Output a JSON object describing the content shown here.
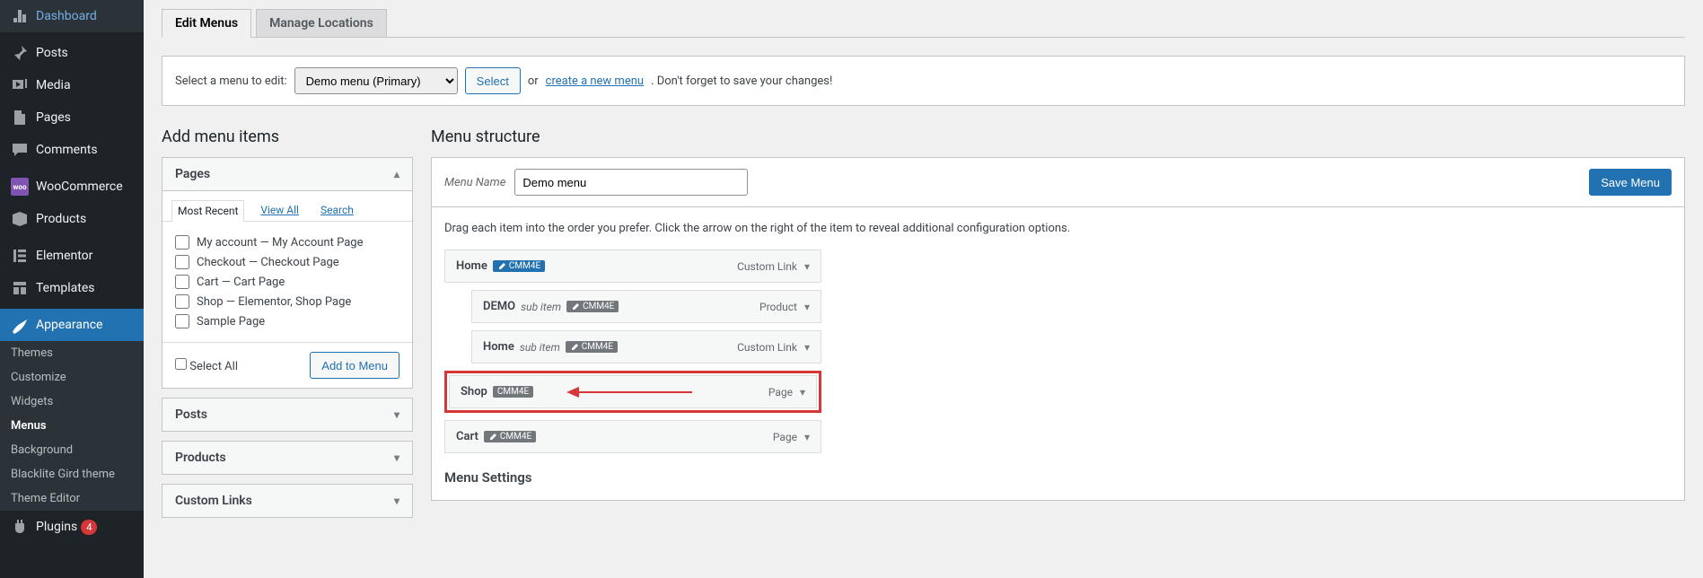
{
  "sidebar": {
    "items": [
      {
        "label": "Dashboard",
        "icon": "dashboard"
      },
      {
        "label": "Posts",
        "icon": "pin"
      },
      {
        "label": "Media",
        "icon": "media"
      },
      {
        "label": "Pages",
        "icon": "pages"
      },
      {
        "label": "Comments",
        "icon": "comments"
      },
      {
        "label": "WooCommerce",
        "icon": "woo"
      },
      {
        "label": "Products",
        "icon": "products"
      },
      {
        "label": "Elementor",
        "icon": "elementor"
      },
      {
        "label": "Templates",
        "icon": "templates"
      },
      {
        "label": "Appearance",
        "icon": "appearance",
        "active": true
      },
      {
        "label": "Plugins",
        "icon": "plugins",
        "badge": "4"
      }
    ],
    "submenu": [
      {
        "label": "Themes"
      },
      {
        "label": "Customize"
      },
      {
        "label": "Widgets"
      },
      {
        "label": "Menus",
        "current": true
      },
      {
        "label": "Background"
      },
      {
        "label": "Blacklite Gird theme"
      },
      {
        "label": "Theme Editor"
      }
    ]
  },
  "tabs": {
    "edit": "Edit Menus",
    "locations": "Manage Locations"
  },
  "edit_bar": {
    "prompt": "Select a menu to edit:",
    "selected": "Demo menu (Primary)",
    "select_btn": "Select",
    "or": "or",
    "create_link": "create a new menu",
    "suffix": ". Don't forget to save your changes!"
  },
  "left": {
    "title": "Add menu items",
    "accordion": {
      "pages": "Pages",
      "posts": "Posts",
      "products": "Products",
      "custom": "Custom Links"
    },
    "inner_tabs": {
      "recent": "Most Recent",
      "view_all": "View All",
      "search": "Search"
    },
    "pages_list": [
      "My account — My Account Page",
      "Checkout — Checkout Page",
      "Cart — Cart Page",
      "Shop — Elementor, Shop Page",
      "Sample Page"
    ],
    "select_all": "Select All",
    "add_btn": "Add to Menu"
  },
  "right": {
    "title": "Menu structure",
    "name_label": "Menu Name",
    "name_value": "Demo menu",
    "save_btn": "Save Menu",
    "hint": "Drag each item into the order you prefer. Click the arrow on the right of the item to reveal additional configuration options.",
    "badge": "CMM4E",
    "items": [
      {
        "title": "Home",
        "type": "Custom Link",
        "depth": 0,
        "badge": "blue"
      },
      {
        "title": "DEMO",
        "sub": "sub item",
        "type": "Product",
        "depth": 1,
        "badge": "gray"
      },
      {
        "title": "Home",
        "sub": "sub item",
        "type": "Custom Link",
        "depth": 1,
        "badge": "gray"
      },
      {
        "title": "Shop",
        "type": "Page",
        "depth": 0,
        "badge": "gray",
        "highlight": true
      },
      {
        "title": "Cart",
        "type": "Page",
        "depth": 0,
        "badge": "gray"
      }
    ],
    "settings_title": "Menu Settings"
  }
}
